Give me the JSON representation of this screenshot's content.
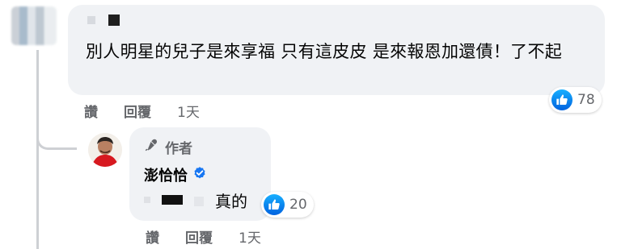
{
  "top_comment": {
    "text": "別人明星的兒子是來享福 只有這皮皮 是來報恩加還債！了不起",
    "reaction_count": "78",
    "actions": {
      "like": "讚",
      "reply": "回覆",
      "time": "1天"
    }
  },
  "reply": {
    "author_badge": "作者",
    "name": "澎恰恰",
    "text": "真的",
    "reaction_count": "20",
    "actions": {
      "like": "讚",
      "reply": "回覆",
      "time": "1天"
    }
  },
  "colors": {
    "bubble_bg": "#f0f2f5",
    "meta_text": "#65676b",
    "like_blue": "#0866ff",
    "verified_blue": "#1877f2"
  },
  "icons": {
    "author": "microphone-icon",
    "verified": "verified-check-icon",
    "reaction": "thumbs-up-icon"
  }
}
